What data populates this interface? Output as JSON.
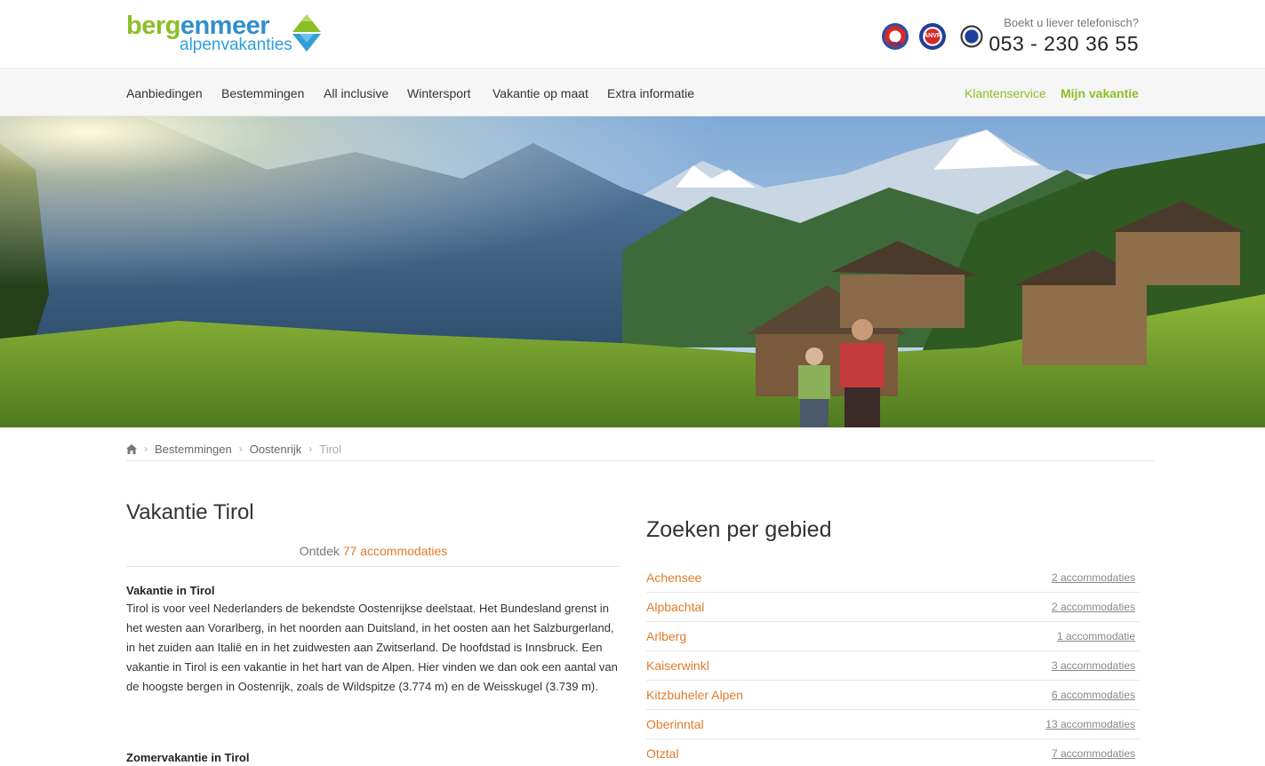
{
  "header": {
    "logo_top_part1": "berg",
    "logo_top_part2": "enmeer",
    "logo_bottom": "alpenvakanties",
    "badges": [
      {
        "label": "SGR",
        "icon": "sgr-badge-icon"
      },
      {
        "label": "ANVR",
        "icon": "anvr-badge-icon"
      },
      {
        "label": "",
        "icon": "calamiteitenfonds-badge-icon"
      }
    ],
    "phone_question": "Boekt u liever telefonisch?",
    "phone_number": "053 - 230 36 55"
  },
  "nav": {
    "items": [
      {
        "label": "Aanbiedingen"
      },
      {
        "label": "Bestemmingen"
      },
      {
        "label": "All inclusive"
      },
      {
        "label": "Wintersport"
      },
      {
        "label": "Vakantie op maat"
      },
      {
        "label": "Extra informatie"
      }
    ],
    "right": [
      {
        "label": "Klantenservice"
      },
      {
        "label": "Mijn vakantie"
      }
    ]
  },
  "breadcrumb": {
    "home_icon": "home-icon",
    "items": [
      "Bestemmingen",
      "Oostenrijk"
    ],
    "current": "Tirol"
  },
  "main": {
    "title": "Vakantie Tirol",
    "discover_prefix": "Ontdek",
    "discover_link": "77 accommodaties",
    "section1_title": "Vakantie in Tirol",
    "section1_text": "Tirol is voor veel Nederlanders de bekendste Oostenrijkse deelstaat. Het Bundesland grenst in het westen aan Vorarlberg, in het noorden aan Duitsland, in het oosten aan het Salzburgerland, in het zuiden aan Italië en in het zuidwesten aan Zwitserland. De hoofdstad is Innsbruck. Een vakantie in Tirol is een vakantie in het hart van de Alpen. Hier vinden we dan ook een aantal van de hoogste bergen in Oostenrijk, zoals de Wildspitze (3.774 m) en de Weisskugel (3.739 m).",
    "section2_title": "Zomervakantie in Tirol"
  },
  "sidebar": {
    "title": "Zoeken per gebied",
    "areas": [
      {
        "name": "Achensee",
        "count": "2 accommodaties"
      },
      {
        "name": "Alpbachtal",
        "count": "2 accommodaties"
      },
      {
        "name": "Arlberg",
        "count": "1 accommodatie"
      },
      {
        "name": "Kaiserwinkl",
        "count": "3 accommodaties"
      },
      {
        "name": "Kitzbuheler Alpen",
        "count": "6 accommodaties"
      },
      {
        "name": "Oberinntal",
        "count": "13 accommodaties"
      },
      {
        "name": "Otztal",
        "count": "7 accommodaties"
      }
    ]
  },
  "colors": {
    "brand_green": "#8cbf26",
    "brand_blue": "#2f8fce",
    "link_orange": "#e07b2b"
  }
}
